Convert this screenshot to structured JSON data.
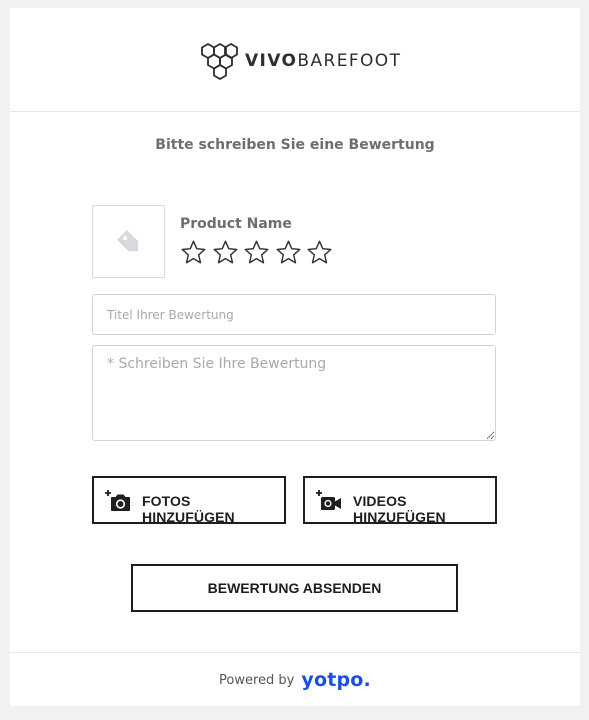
{
  "brand": {
    "logo_bold": "VIVO",
    "logo_light": "BAREFOOT",
    "icon": "hexagon-cluster-icon"
  },
  "form": {
    "title": "Bitte schreiben Sie eine Bewertung",
    "product_name": "Product Name",
    "product_image_icon": "price-tag-icon",
    "rating": {
      "max": 5,
      "value": 0,
      "icon": "star-outline-icon"
    },
    "title_placeholder": "Titel Ihrer Bewertung",
    "body_placeholder": "* Schreiben Sie Ihre Bewertung",
    "add_photos_label": "FOTOS HINZUFÜGEN",
    "add_photos_icon": "camera-plus-icon",
    "add_videos_label": "VIDEOS HINZUFÜGEN",
    "add_videos_icon": "video-camera-plus-icon",
    "submit_label": "BEWERTUNG ABSENDEN"
  },
  "footer": {
    "powered_by": "Powered by",
    "provider": "yotpo."
  },
  "colors": {
    "background": "#f1f1f1",
    "card": "#ffffff",
    "title_text": "#6a6f75",
    "button_border": "#1e1e1e",
    "yotpo_blue": "#1c4ee5",
    "star_outline": "#333333"
  }
}
